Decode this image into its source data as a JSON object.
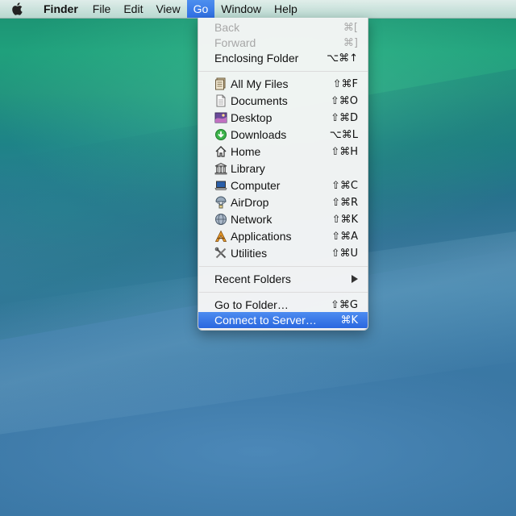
{
  "menubar": {
    "apple_icon": "apple-icon",
    "app_name": "Finder",
    "menus": [
      "File",
      "Edit",
      "View",
      "Go",
      "Window",
      "Help"
    ],
    "active_menu": "Go"
  },
  "go_menu": {
    "items": [
      {
        "label": "Back",
        "shortcut": "⌘[",
        "enabled": false
      },
      {
        "label": "Forward",
        "shortcut": "⌘]",
        "enabled": false
      },
      {
        "label": "Enclosing Folder",
        "shortcut": "⌥⌘↑",
        "enabled": true
      },
      {
        "label": "All My Files",
        "shortcut": "⇧⌘F",
        "icon": "all-my-files-icon"
      },
      {
        "label": "Documents",
        "shortcut": "⇧⌘O",
        "icon": "documents-icon"
      },
      {
        "label": "Desktop",
        "shortcut": "⇧⌘D",
        "icon": "desktop-icon"
      },
      {
        "label": "Downloads",
        "shortcut": "⌥⌘L",
        "icon": "downloads-icon"
      },
      {
        "label": "Home",
        "shortcut": "⇧⌘H",
        "icon": "home-icon"
      },
      {
        "label": "Library",
        "shortcut": "",
        "icon": "library-icon"
      },
      {
        "label": "Computer",
        "shortcut": "⇧⌘C",
        "icon": "computer-icon"
      },
      {
        "label": "AirDrop",
        "shortcut": "⇧⌘R",
        "icon": "airdrop-icon"
      },
      {
        "label": "Network",
        "shortcut": "⇧⌘K",
        "icon": "network-icon"
      },
      {
        "label": "Applications",
        "shortcut": "⇧⌘A",
        "icon": "applications-icon"
      },
      {
        "label": "Utilities",
        "shortcut": "⇧⌘U",
        "icon": "utilities-icon"
      },
      {
        "label": "Recent Folders",
        "submenu": true
      },
      {
        "label": "Go to Folder…",
        "shortcut": "⇧⌘G"
      },
      {
        "label": "Connect to Server…",
        "shortcut": "⌘K",
        "highlighted": true
      }
    ]
  },
  "colors": {
    "highlight": "#2f6fe4",
    "disabled_text": "#a7a7a7"
  }
}
